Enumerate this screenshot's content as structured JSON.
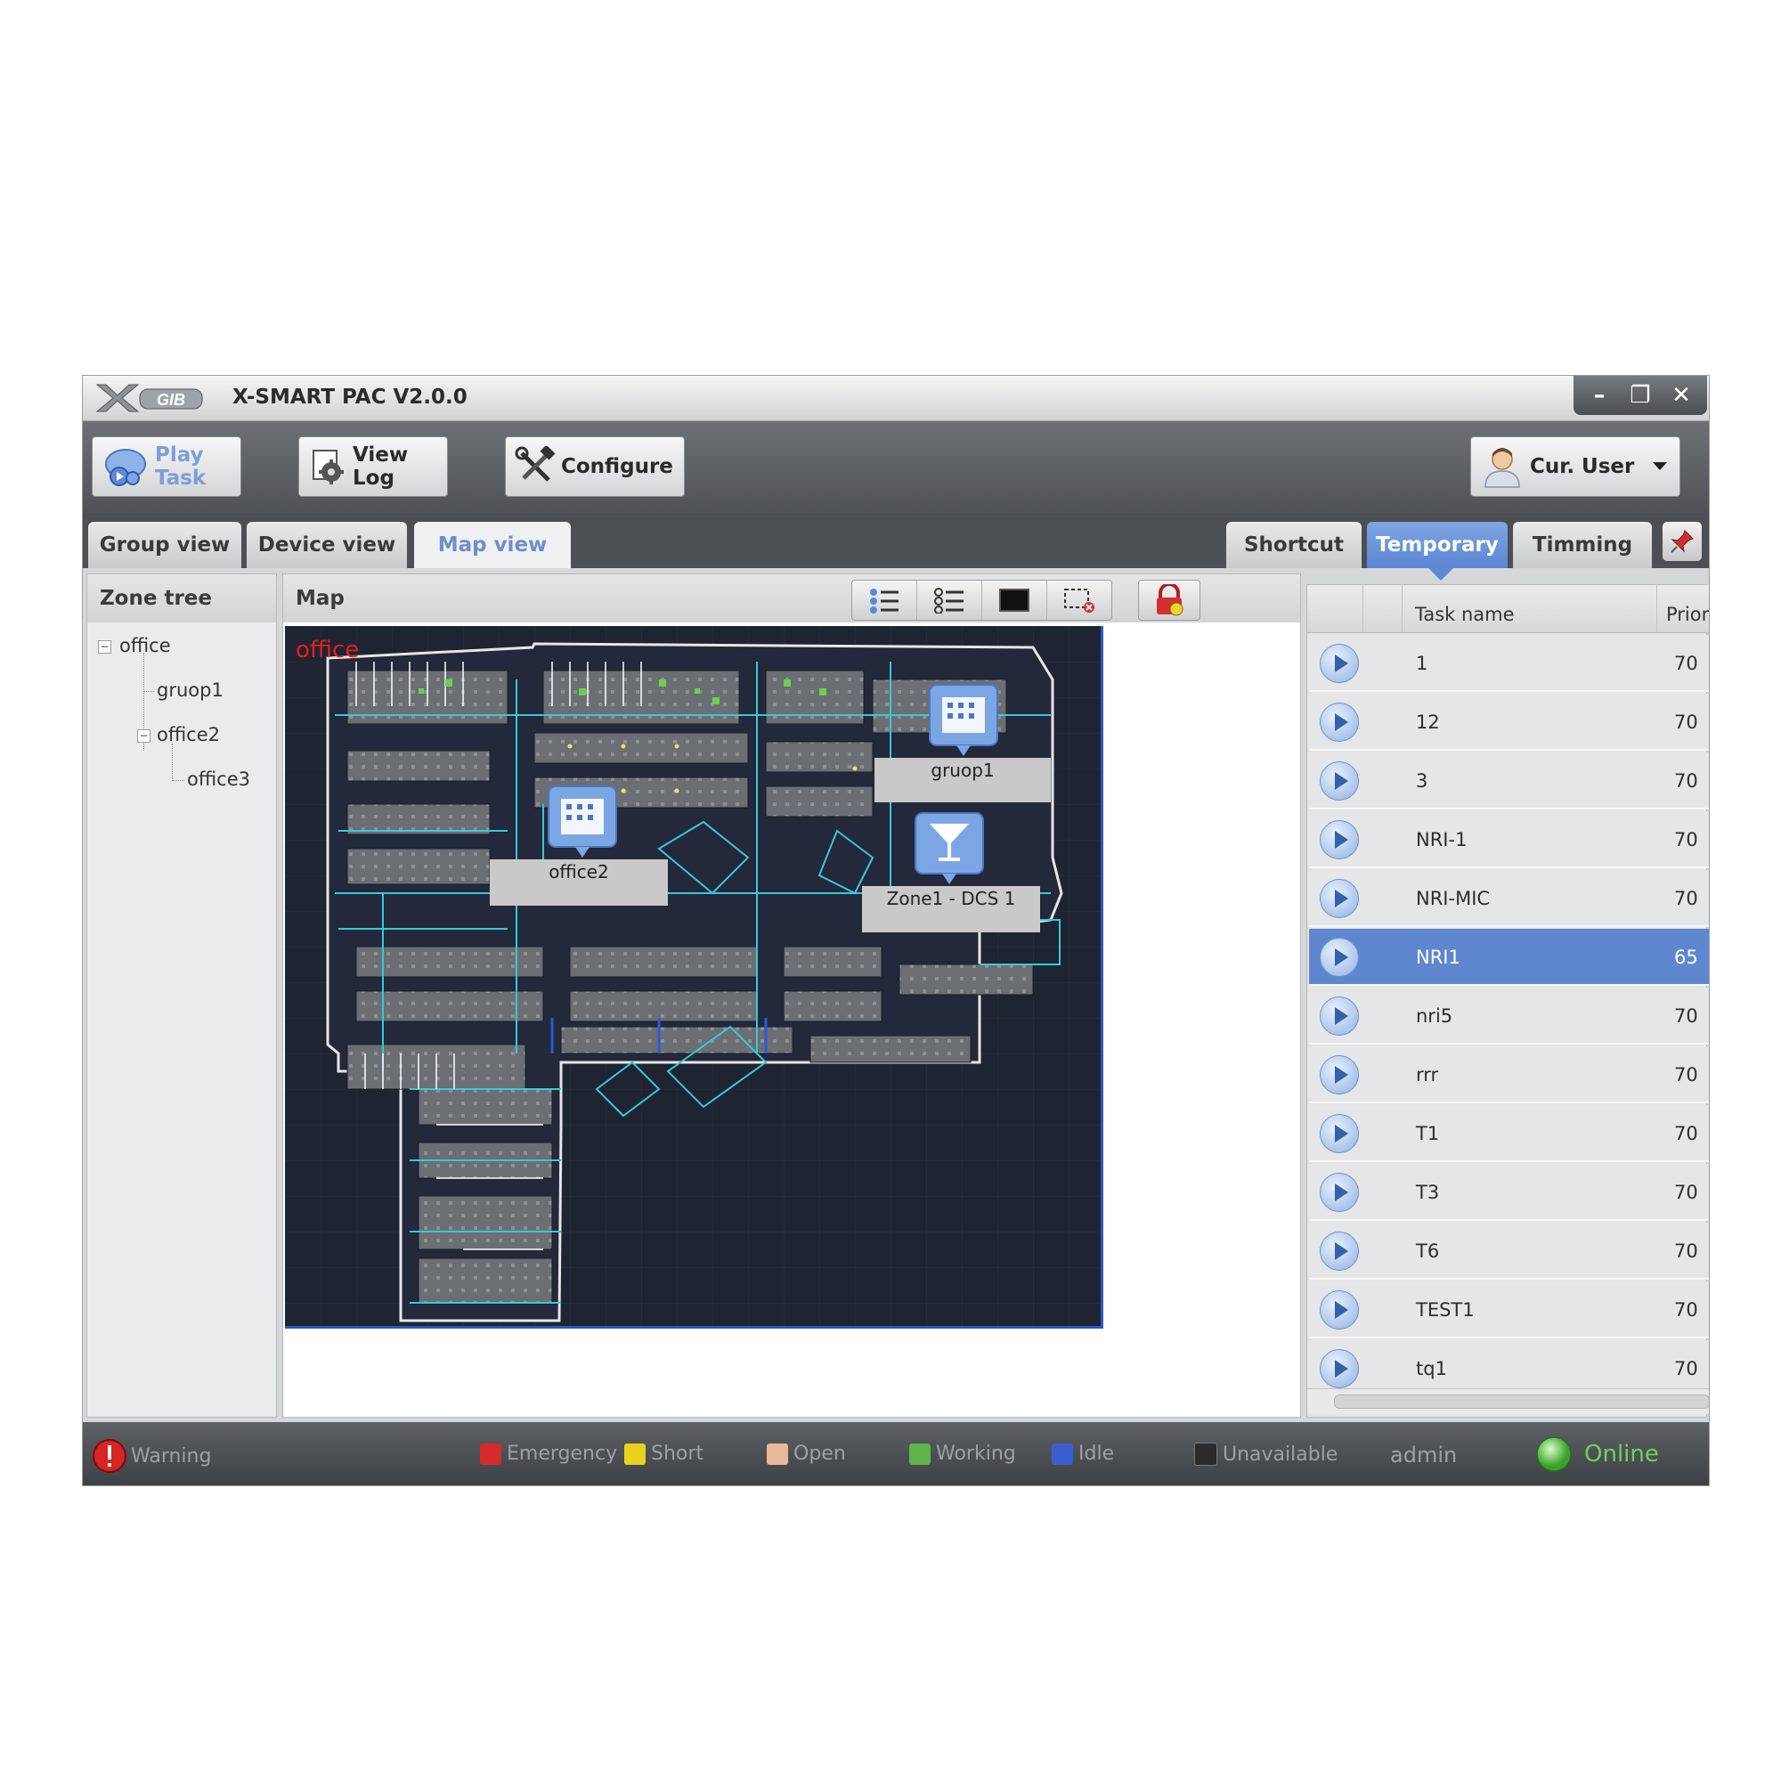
{
  "window": {
    "logo_text": "GIB",
    "title": "X-SMART PAC V2.0.0",
    "controls": [
      "–",
      "❐",
      "✕"
    ]
  },
  "toolbar": {
    "play_task": "Play Task",
    "view_log": "View Log",
    "configure": "Configure",
    "cur_user": "Cur. User"
  },
  "tabs": {
    "left": [
      "Group view",
      "Device view",
      "Map view"
    ],
    "left_active": "Map view",
    "right": [
      "Shortcut",
      "Temporary",
      "Timming"
    ],
    "right_active": "Temporary"
  },
  "zone_tree": {
    "title": "Zone tree",
    "nodes": [
      {
        "label": "office",
        "expanded": true
      },
      {
        "label": "gruop1"
      },
      {
        "label": "office2",
        "expanded": true
      },
      {
        "label": "office3"
      }
    ]
  },
  "map": {
    "title": "Map",
    "zone_label": "office",
    "markers": [
      {
        "label": "gruop1",
        "icon": "building-icon"
      },
      {
        "label": "office2",
        "icon": "building-icon"
      },
      {
        "label": "Zone1 - DCS 1",
        "icon": "cocktail-glass-icon"
      }
    ]
  },
  "tasks": {
    "columns": [
      "Task name",
      "Priority"
    ],
    "rows": [
      {
        "name": "1",
        "priority": "70",
        "loop": false
      },
      {
        "name": "12",
        "priority": "70",
        "loop": false
      },
      {
        "name": "3",
        "priority": "70",
        "loop": false
      },
      {
        "name": "NRI-1",
        "priority": "70",
        "loop": true
      },
      {
        "name": "NRI-MIC",
        "priority": "70",
        "loop": false
      },
      {
        "name": "NRI1",
        "priority": "65",
        "loop": false,
        "selected": true
      },
      {
        "name": "nri5",
        "priority": "70",
        "loop": true
      },
      {
        "name": "rrr",
        "priority": "70",
        "loop": false
      },
      {
        "name": "T1",
        "priority": "70",
        "loop": false
      },
      {
        "name": "T3",
        "priority": "70",
        "loop": false
      },
      {
        "name": "T6",
        "priority": "70",
        "loop": false
      },
      {
        "name": "TEST1",
        "priority": "70",
        "loop": true
      },
      {
        "name": "tq1",
        "priority": "70",
        "loop": true
      }
    ]
  },
  "status": {
    "warning": "Warning",
    "legend": [
      {
        "label": "Emergency",
        "color": "#d42a2a"
      },
      {
        "label": "Short",
        "color": "#e8d21c"
      },
      {
        "label": "Open",
        "color": "#e6b99a"
      },
      {
        "label": "Working",
        "color": "#5fb44a"
      },
      {
        "label": "Idle",
        "color": "#3c5fd0"
      },
      {
        "label": "Unavailable",
        "color": "#2a2a2a"
      }
    ],
    "user": "admin",
    "connection": "Online"
  },
  "colors": {
    "accent_blue": "#5e87d0",
    "online_green": "#6ed15a",
    "map_bg": "#1f2432"
  }
}
